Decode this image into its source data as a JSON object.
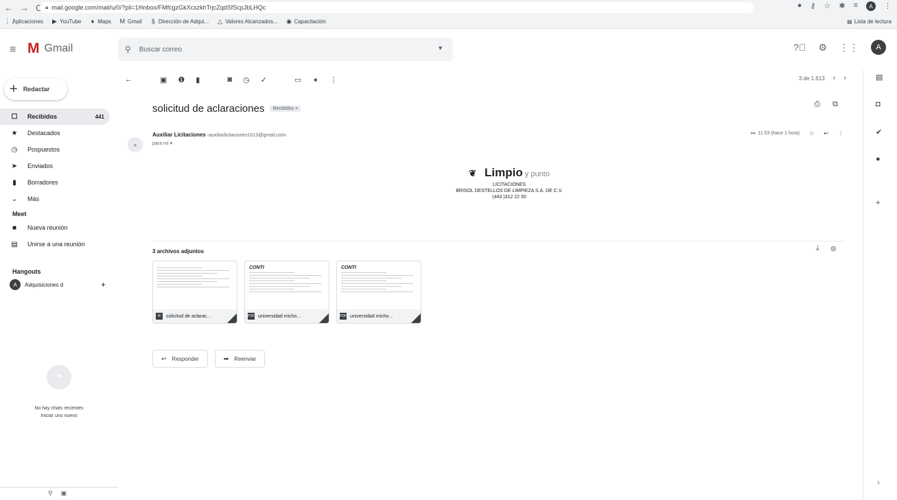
{
  "browser": {
    "back": "←",
    "forward": "→",
    "reload": "C",
    "url": "mail.google.com/mail/u/0/?pli=1#inbox/FMfcgzGkXcxzkhTrjcZqdSfScpJbLHQc",
    "bookmarks": [
      {
        "icon": "apps-grid-icon",
        "glyph": "⋮⋮",
        "label": "Aplicaciones"
      },
      {
        "icon": "youtube-icon",
        "glyph": "▶",
        "label": "YouTube"
      },
      {
        "icon": "maps-pin-icon",
        "glyph": "♦",
        "label": "Maps"
      },
      {
        "icon": "gmail-icon",
        "glyph": "M",
        "label": "Gmail"
      },
      {
        "icon": "bookmark-site-icon",
        "glyph": "§",
        "label": "Dirección de Adqui..."
      },
      {
        "icon": "drive-icon",
        "glyph": "△",
        "label": "Valores Alcanzados..."
      },
      {
        "icon": "globe-icon",
        "glyph": "◉",
        "label": "Capacitación"
      }
    ],
    "reading_list": "Lista de lectura",
    "avatar_letter": "A"
  },
  "header": {
    "app_name": "Gmail",
    "search_placeholder": "Buscar correo",
    "avatar_letter": "A"
  },
  "sidebar": {
    "compose_label": "Redactar",
    "items": [
      {
        "label": "Recibidos",
        "count": "441",
        "icon": "inbox-icon",
        "glyph": "☐",
        "active": true
      },
      {
        "label": "Destacados",
        "count": "",
        "icon": "star-icon",
        "glyph": "★",
        "active": false
      },
      {
        "label": "Pospuestos",
        "count": "",
        "icon": "clock-icon",
        "glyph": "◷",
        "active": false
      },
      {
        "label": "Enviados",
        "count": "",
        "icon": "send-icon",
        "glyph": "➤",
        "active": false
      },
      {
        "label": "Borradores",
        "count": "",
        "icon": "draft-icon",
        "glyph": "▮",
        "active": false
      },
      {
        "label": "Más",
        "count": "",
        "icon": "chevron-down-icon",
        "glyph": "⌄",
        "active": false
      }
    ],
    "meet_heading": "Meet",
    "meet_items": [
      {
        "label": "Nueva reunión",
        "icon": "video-icon",
        "glyph": "■"
      },
      {
        "label": "Unirse a una reunión",
        "icon": "keyboard-icon",
        "glyph": "▤"
      }
    ],
    "hangouts_heading": "Hangouts",
    "hangouts_user": "Adquisiciones d",
    "hangouts_user_initial": "A",
    "chat_empty_line1": "No hay chats recientes",
    "chat_empty_line2": "Iniciar uno nuevo"
  },
  "toolbar": {
    "pager": "3 de 1.613"
  },
  "message": {
    "subject": "solicitud de aclaraciones",
    "label_badge": "Recibidos ×",
    "sender_name": "Auxiliar Licitaciones",
    "sender_email": "‹auxiliarlicitaciones1013@gmail.com›",
    "recipient": "para mí ▾",
    "time": "11:53 (hace 1 hora)",
    "signature": {
      "brand": "Limpio",
      "brand_suffix": "y punto",
      "line1": "LICITACIONES",
      "line2": "BRISOL DESTELLOS DE LIMPIEZA S.A. DE C.V.",
      "line3": "(443 )312 22 30"
    },
    "attachments_title": "3 archivos adjuntos",
    "attachments": [
      {
        "name": "solicitud de aclarac...",
        "type": "W",
        "brand": ""
      },
      {
        "name": "universidad micho...",
        "type": "PDF",
        "brand": "CONTI"
      },
      {
        "name": "universidad micho...",
        "type": "PDF",
        "brand": "CONTI"
      }
    ],
    "reply_label": "Responder",
    "forward_label": "Reenviar"
  }
}
